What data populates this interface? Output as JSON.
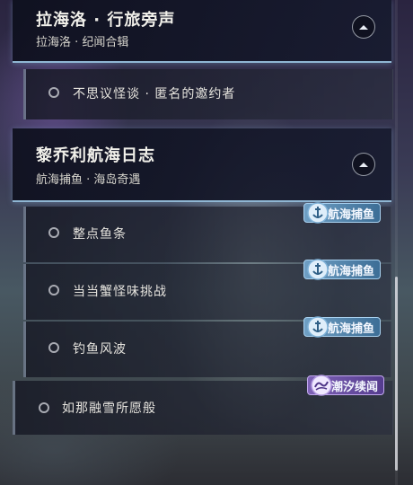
{
  "groups": [
    {
      "title": "拉海洛 · 行旅旁声",
      "subtitle": "拉海洛 · 纪闻合辑"
    },
    {
      "title": "黎乔利航海日志",
      "subtitle": "航海捕鱼 · 海岛奇遇"
    }
  ],
  "quests": [
    {
      "label": "不思议怪谈 · 匿名的邀约者",
      "tag": ""
    },
    {
      "label": "整点鱼条",
      "tag": "航海捕鱼"
    },
    {
      "label": "当当蟹怪味挑战",
      "tag": "航海捕鱼"
    },
    {
      "label": "钓鱼风波",
      "tag": "航海捕鱼"
    },
    {
      "label": "如那融雪所愿般",
      "tag": "潮汐续闻"
    }
  ],
  "colors": {
    "fishing_tag": "#4f86b0",
    "tide_tag": "#6a4fa6",
    "header_underline": "#8fb6d3"
  },
  "icons": {
    "collapse": "chevron-up-icon",
    "quest_status": "radio-circle-icon",
    "fishing_tag": "anchor-icon",
    "tide_tag": "wave-icon"
  }
}
